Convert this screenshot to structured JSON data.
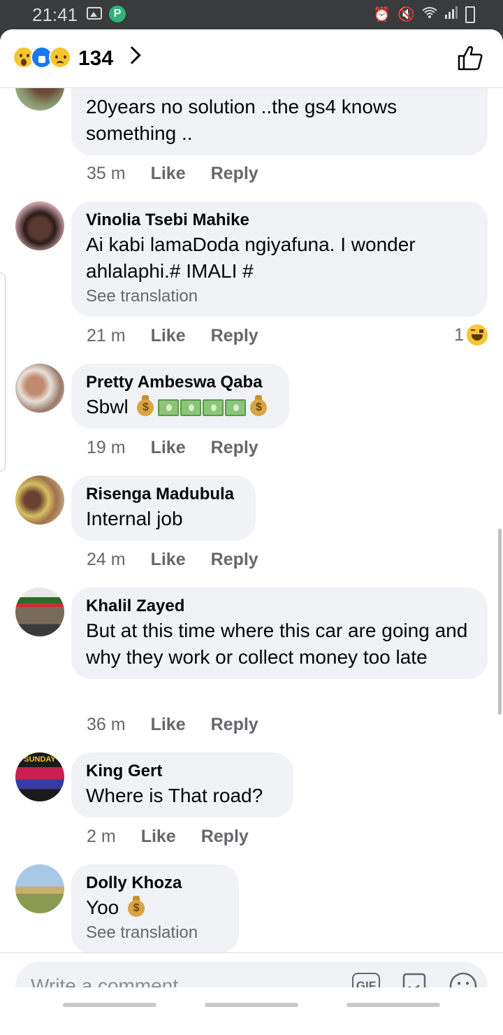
{
  "status_bar": {
    "time": "21:41",
    "app_letter": "P"
  },
  "header": {
    "reaction_count": "134"
  },
  "comments": [
    {
      "author": "",
      "text": "20years no solution  ..the gs4 knows something ..",
      "time": "35 m",
      "like": "Like",
      "reply": "Reply"
    },
    {
      "author": "Vinolia Tsebi Mahike",
      "text": "Ai kabi lamaDoda ngiyafuna. I wonder ahlalaphi.# IMALI #",
      "see_translation": "See translation",
      "time": "21 m",
      "like": "Like",
      "reply": "Reply",
      "reaction_count": "1"
    },
    {
      "author": "Pretty Ambeswa Qaba",
      "text": "Sbwl",
      "time": "19 m",
      "like": "Like",
      "reply": "Reply"
    },
    {
      "author": "Risenga Madubula",
      "text": "Internal job",
      "time": "24 m",
      "like": "Like",
      "reply": "Reply"
    },
    {
      "author": "Khalil Zayed",
      "text": "But at this time where this car are going and why they work or collect money too late",
      "time": "36 m",
      "like": "Like",
      "reply": "Reply"
    },
    {
      "author": "King Gert",
      "text": "Where is That road?",
      "time": "2 m",
      "like": "Like",
      "reply": "Reply",
      "avatar_text": "SUNDAY"
    },
    {
      "author": "Dolly Khoza",
      "text": "Yoo",
      "see_translation": "See translation"
    }
  ],
  "composer": {
    "placeholder": "Write a comment…",
    "gif_label": "GIF"
  },
  "icons": {
    "reactions": [
      "wow-icon",
      "like-icon",
      "sad-icon"
    ],
    "haha": "haha-icon",
    "money_bag": "money-bag-icon",
    "money_bill": "dollar-banknote-icon"
  },
  "colors": {
    "bubble": "#f0f2f5",
    "secondary_text": "#65676b",
    "like_blue": "#1877f2"
  }
}
